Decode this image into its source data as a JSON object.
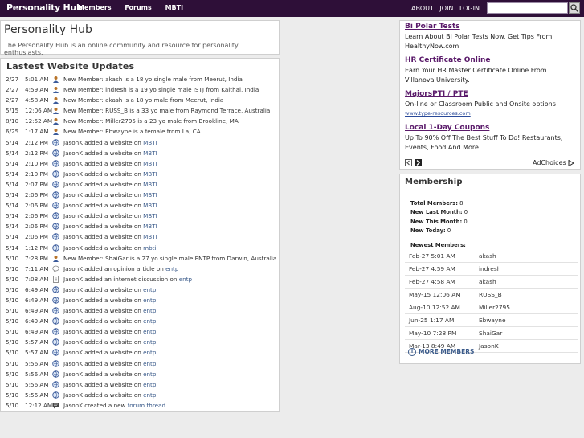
{
  "header": {
    "brand": "Personality Hub",
    "nav_left": [
      "Members",
      "Forums",
      "MBTI"
    ],
    "nav_right": [
      "ABOUT",
      "JOIN",
      "LOGIN"
    ],
    "search_value": ""
  },
  "intro": {
    "title": "Personality Hub",
    "description": "The Personality Hub is an online community and resource for personality enthusiasts."
  },
  "updates": {
    "title": "Lastest Website Updates",
    "items": [
      {
        "date": "2/27",
        "time": "5:01 AM",
        "icon": "user-icon",
        "text": "New Member: akash is a 18 yo single male from Meerut, India",
        "link": ""
      },
      {
        "date": "2/27",
        "time": "4:59 AM",
        "icon": "user-icon",
        "text": "New Member: indresh is a 19 yo single male ISTJ from Kaithal, India",
        "link": ""
      },
      {
        "date": "2/27",
        "time": "4:58 AM",
        "icon": "user-icon",
        "text": "New Member: akash is a 18 yo male from Meerut, India",
        "link": ""
      },
      {
        "date": "5/15",
        "time": "12:06 AM",
        "icon": "user-icon",
        "text": "New Member: RUSS_B is a 33 yo male from Raymond Terrace, Australia",
        "link": ""
      },
      {
        "date": "8/10",
        "time": "12:52 AM",
        "icon": "user-icon",
        "text": "New Member: Miller2795 is a 23 yo male from Brookline, MA",
        "link": ""
      },
      {
        "date": "6/25",
        "time": "1:17 AM",
        "icon": "user-icon",
        "text": "New Member: Ebwayne is a female from La, CA",
        "link": ""
      },
      {
        "date": "5/14",
        "time": "2:12 PM",
        "icon": "website-icon",
        "text": "JasonK added a website on ",
        "link": "MBTI"
      },
      {
        "date": "5/14",
        "time": "2:12 PM",
        "icon": "website-icon",
        "text": "JasonK added a website on ",
        "link": "MBTI"
      },
      {
        "date": "5/14",
        "time": "2:10 PM",
        "icon": "website-icon",
        "text": "JasonK added a website on ",
        "link": "MBTI"
      },
      {
        "date": "5/14",
        "time": "2:10 PM",
        "icon": "website-icon",
        "text": "JasonK added a website on ",
        "link": "MBTI"
      },
      {
        "date": "5/14",
        "time": "2:07 PM",
        "icon": "website-icon",
        "text": "JasonK added a website on ",
        "link": "MBTI"
      },
      {
        "date": "5/14",
        "time": "2:06 PM",
        "icon": "website-icon",
        "text": "JasonK added a website on ",
        "link": "MBTI"
      },
      {
        "date": "5/14",
        "time": "2:06 PM",
        "icon": "website-icon",
        "text": "JasonK added a website on ",
        "link": "MBTI"
      },
      {
        "date": "5/14",
        "time": "2:06 PM",
        "icon": "website-icon",
        "text": "JasonK added a website on ",
        "link": "MBTI"
      },
      {
        "date": "5/14",
        "time": "2:06 PM",
        "icon": "website-icon",
        "text": "JasonK added a website on ",
        "link": "MBTI"
      },
      {
        "date": "5/14",
        "time": "2:06 PM",
        "icon": "website-icon",
        "text": "JasonK added a website on ",
        "link": "MBTI"
      },
      {
        "date": "5/14",
        "time": "1:12 PM",
        "icon": "website-icon",
        "text": "JasonK added a website on ",
        "link": "mbti"
      },
      {
        "date": "5/10",
        "time": "7:28 PM",
        "icon": "user-icon",
        "text": "New Member: ShaiGar is a 27 yo single male ENTP from Darwin, Australia",
        "link": ""
      },
      {
        "date": "5/10",
        "time": "7:11 AM",
        "icon": "comment-icon",
        "text": "JasonK added an opinion article on ",
        "link": "entp"
      },
      {
        "date": "5/10",
        "time": "7:08 AM",
        "icon": "document-icon",
        "text": "JasonK added an internet discussion on ",
        "link": "entp"
      },
      {
        "date": "5/10",
        "time": "6:49 AM",
        "icon": "website-icon",
        "text": "JasonK added a website on ",
        "link": "entp"
      },
      {
        "date": "5/10",
        "time": "6:49 AM",
        "icon": "website-icon",
        "text": "JasonK added a website on ",
        "link": "entp"
      },
      {
        "date": "5/10",
        "time": "6:49 AM",
        "icon": "website-icon",
        "text": "JasonK added a website on ",
        "link": "entp"
      },
      {
        "date": "5/10",
        "time": "6:49 AM",
        "icon": "website-icon",
        "text": "JasonK added a website on ",
        "link": "entp"
      },
      {
        "date": "5/10",
        "time": "6:49 AM",
        "icon": "website-icon",
        "text": "JasonK added a website on ",
        "link": "entp"
      },
      {
        "date": "5/10",
        "time": "5:57 AM",
        "icon": "website-icon",
        "text": "JasonK added a website on ",
        "link": "entp"
      },
      {
        "date": "5/10",
        "time": "5:57 AM",
        "icon": "website-icon",
        "text": "JasonK added a website on ",
        "link": "entp"
      },
      {
        "date": "5/10",
        "time": "5:56 AM",
        "icon": "website-icon",
        "text": "JasonK added a website on ",
        "link": "entp"
      },
      {
        "date": "5/10",
        "time": "5:56 AM",
        "icon": "website-icon",
        "text": "JasonK added a website on ",
        "link": "entp"
      },
      {
        "date": "5/10",
        "time": "5:56 AM",
        "icon": "website-icon",
        "text": "JasonK added a website on ",
        "link": "entp"
      },
      {
        "date": "5/10",
        "time": "5:56 AM",
        "icon": "website-icon",
        "text": "JasonK added a website on ",
        "link": "entp"
      },
      {
        "date": "5/10",
        "time": "12:12 AM",
        "icon": "forum-icon",
        "text": "JasonK created a new ",
        "link": "forum thread"
      }
    ]
  },
  "ads": [
    {
      "title": "Bi Polar Tests",
      "body": "Learn About Bi Polar Tests Now. Get Tips From HealthyNow.com",
      "url": ""
    },
    {
      "title": "HR Certificate Online",
      "body": "Earn Your HR Master Certificate Online From Villanova University.",
      "url": ""
    },
    {
      "title": "MajorsPTI / PTE",
      "body": "On-line or Classroom Public and Onsite options",
      "url": "www.type-resources.com"
    },
    {
      "title": "Local 1-Day Coupons",
      "body": "Up To 90% Off The Best Stuff To Do! Restaurants, Events, Food And More.",
      "url": ""
    }
  ],
  "adchoices_label": "AdChoices",
  "membership": {
    "title": "Membership",
    "stats": [
      {
        "label": "Total Members:",
        "value": "8"
      },
      {
        "label": "New Last Month:",
        "value": "0"
      },
      {
        "label": "New This Month:",
        "value": "0"
      },
      {
        "label": "New Today:",
        "value": "0"
      }
    ],
    "newest_label": "Newest Members:",
    "newest": [
      {
        "date": "Feb-27 5:01 AM",
        "name": "akash"
      },
      {
        "date": "Feb-27 4:59 AM",
        "name": "indresh"
      },
      {
        "date": "Feb-27 4:58 AM",
        "name": "akash"
      },
      {
        "date": "May-15 12:06 AM",
        "name": "RUSS_B"
      },
      {
        "date": "Aug-10 12:52 AM",
        "name": "Miller2795"
      },
      {
        "date": "Jun-25 1:17 AM",
        "name": "Ebwayne"
      },
      {
        "date": "May-10 7:28 PM",
        "name": "ShaiGar"
      },
      {
        "date": "Mar-13 8:49 AM",
        "name": "JasonK"
      }
    ],
    "more_label": "MORE MEMBERS"
  },
  "colors": {
    "topbar": "#2e0f38",
    "link": "#3a5a8a",
    "ad_title": "#5a1a6a"
  }
}
